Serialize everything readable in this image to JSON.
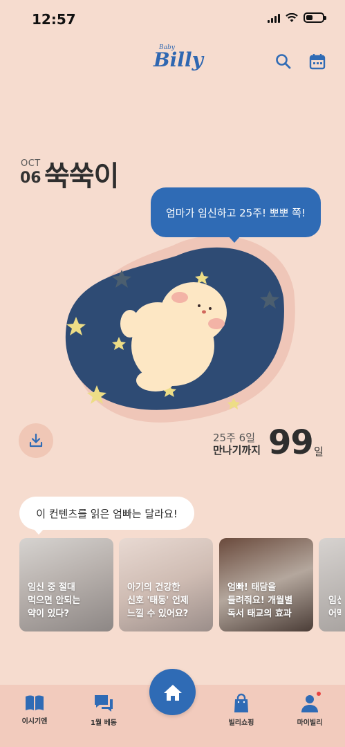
{
  "status_bar": {
    "time": "12:57"
  },
  "header": {
    "logo_small": "Baby",
    "logo": "Billy"
  },
  "profile": {
    "month": "OCT",
    "day": "06",
    "nickname": "쑥쑥이",
    "speech": "엄마가 임신하고 25주! 뽀뽀 쪽!"
  },
  "dday": {
    "week_label": "25주 6일",
    "until_label": "만나기까지",
    "days_left": "99",
    "unit": "일"
  },
  "tooltip": "이 컨텐츠를 읽은 엄빠는 달라요!",
  "cards": [
    {
      "lines": [
        "임신 중 절대",
        "먹으면 안되는",
        "약이 있다?"
      ]
    },
    {
      "lines": [
        "아기의 건강한",
        "신호 '태동' 언제",
        "느낄 수 있어요?"
      ]
    },
    {
      "lines": [
        "엄빠! 태담을",
        "들려줘요! 개월별",
        "독서 태교의 효과"
      ]
    },
    {
      "lines": [
        "임신",
        "어떡"
      ]
    }
  ],
  "nav": {
    "items": [
      {
        "label": "이시기엔",
        "icon": "book-icon"
      },
      {
        "label": "1월 베동",
        "icon": "chat-icon"
      },
      {
        "label": "",
        "icon": "home-icon"
      },
      {
        "label": "빌리쇼핑",
        "icon": "shopping-bag-icon"
      },
      {
        "label": "마이빌리",
        "icon": "person-icon"
      }
    ]
  },
  "colors": {
    "accent": "#2f6bb5",
    "background": "#f6dccf",
    "badge": "#e9413f"
  }
}
